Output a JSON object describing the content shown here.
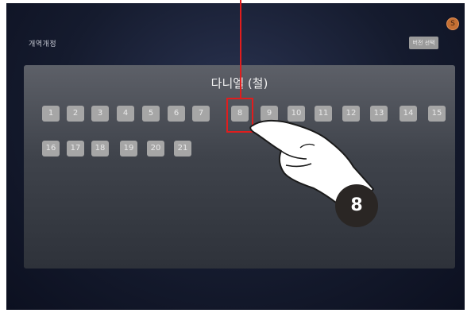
{
  "app": {
    "title": "개역개정"
  },
  "header": {
    "version_label": "버전 선택",
    "close_symbol": "S"
  },
  "book": {
    "title": "다니엘 (철)"
  },
  "chapters": [
    "1",
    "2",
    "3",
    "4",
    "5",
    "6",
    "7",
    "8",
    "9",
    "10",
    "11",
    "12",
    "13",
    "14",
    "15",
    "16",
    "17",
    "18",
    "19",
    "20",
    "21"
  ],
  "selected_chapter": "8",
  "step": {
    "number": "8"
  },
  "colors": {
    "highlight": "#e11d1d",
    "chapter_bg": "#a6a6a6",
    "close_button": "#c46f33",
    "step_badge": "#2a2624"
  }
}
